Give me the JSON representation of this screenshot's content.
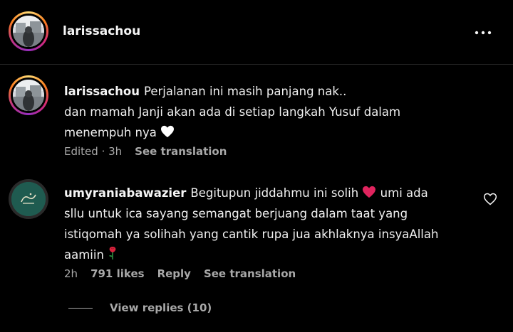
{
  "header": {
    "username": "larissachou",
    "more_icon": "more-horizontal-icon"
  },
  "comments": [
    {
      "username": "larissachou",
      "lines": [
        "Perjalanan ini masih panjang nak..",
        "dan mamah Janji akan ada di setiap langkah Yusuf dalam",
        "menempuh nya"
      ],
      "trailing_emoji": "white-heart-icon",
      "meta": {
        "time": "Edited · 3h",
        "see_translation": "See translation"
      }
    },
    {
      "username": "umyraniabawazier",
      "first_line_text": "Begitupun jiddahmu ini solih",
      "first_line_emoji": "red-heart-icon",
      "first_line_after": "umi ada",
      "lines": [
        "sllu untuk ica sayang semangat berjuang dalam taat yang",
        "istiqomah ya solihah yang cantik rupa jua akhlaknya insyaAllah",
        "aamiin"
      ],
      "trailing_emoji": "rose-icon",
      "meta": {
        "time": "2h",
        "likes": "791 likes",
        "reply": "Reply",
        "see_translation": "See translation"
      },
      "like_icon": "heart-outline-icon",
      "view_replies": "View replies (10)"
    }
  ],
  "colors": {
    "background": "#000000",
    "text": "#f5f5f5",
    "secondary": "#a8a8a8",
    "heart_red": "#e0245e"
  }
}
